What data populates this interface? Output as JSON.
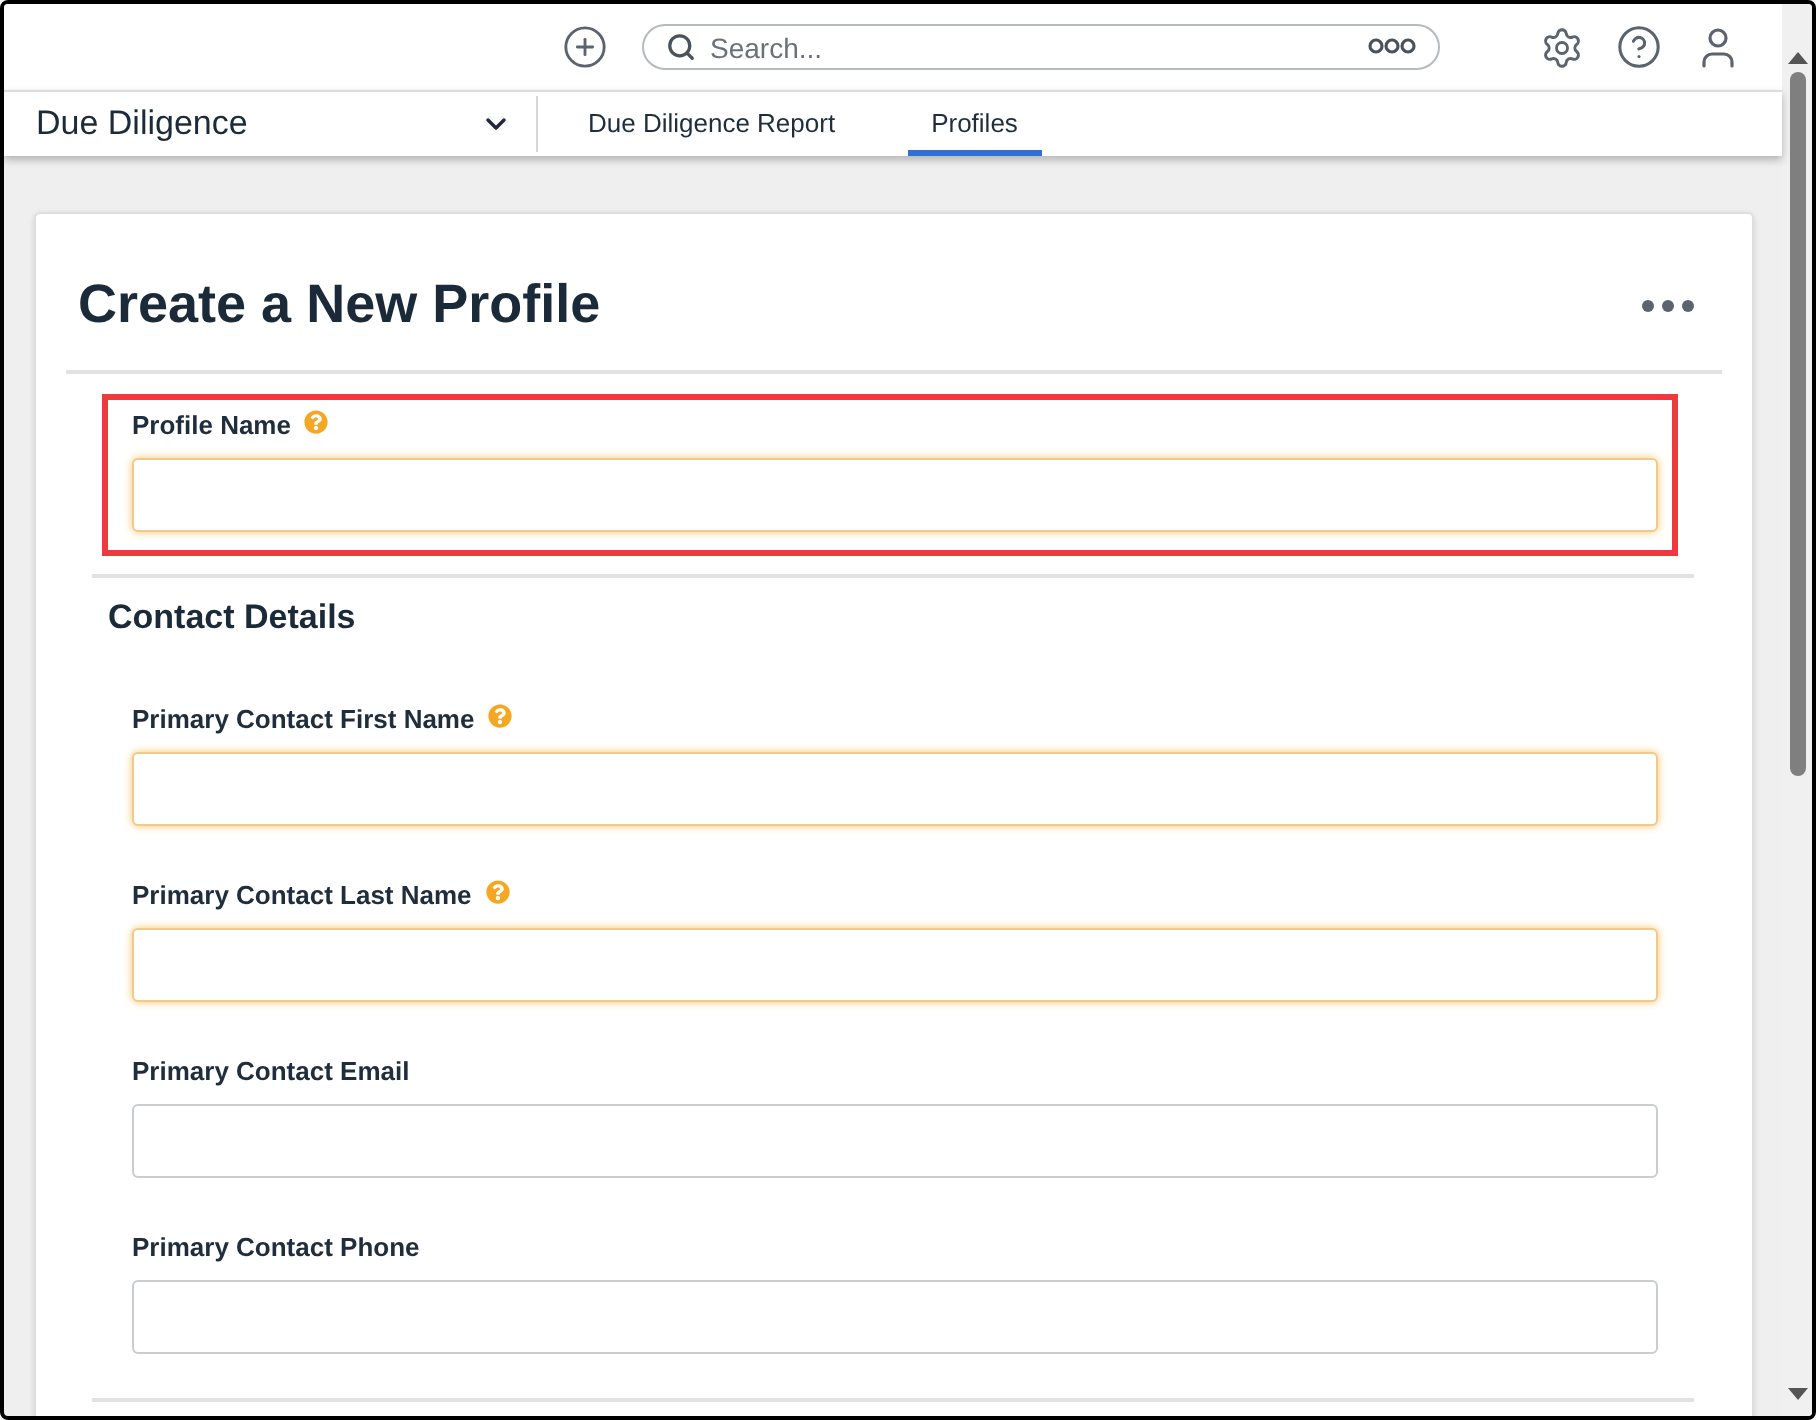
{
  "top_bar": {
    "search": {
      "placeholder": "Search..."
    }
  },
  "nav": {
    "app_name": "Due Diligence",
    "tabs": [
      {
        "label": "Due Diligence Report",
        "selected": false
      },
      {
        "label": "Profiles",
        "selected": true
      }
    ]
  },
  "form": {
    "title": "Create a New Profile",
    "sections": [
      {
        "fields": [
          {
            "label": "Profile Name",
            "required": true,
            "help": true,
            "highlighted": true
          }
        ]
      },
      {
        "title": "Contact Details",
        "fields": [
          {
            "label": "Primary Contact First Name",
            "required": true,
            "help": true,
            "highlighted": false
          },
          {
            "label": "Primary Contact Last Name",
            "required": true,
            "help": true,
            "highlighted": false
          },
          {
            "label": "Primary Contact Email",
            "required": false,
            "help": false,
            "highlighted": false
          },
          {
            "label": "Primary Contact Phone",
            "required": false,
            "help": false,
            "highlighted": false
          }
        ]
      }
    ]
  }
}
